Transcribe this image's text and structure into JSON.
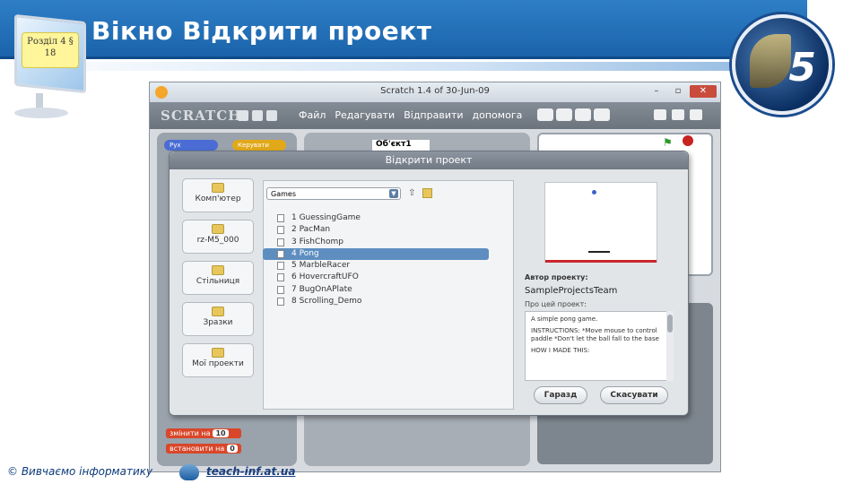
{
  "slide": {
    "title": "Вікно Відкрити проект",
    "section_label_line1": "Розділ 4 §",
    "section_label_line2": "18",
    "logo_number": "5"
  },
  "footer": {
    "copyright": "© Вивчаємо інформатику",
    "site": "teach-inf.at.ua"
  },
  "scratch": {
    "window_title": "Scratch 1.4 of 30-Jun-09",
    "logo_text": "SCRATCH",
    "menu": [
      "Файл",
      "Редагувати",
      "Відправити",
      "допомога"
    ],
    "window_buttons": [
      "–",
      "▫",
      "✕"
    ],
    "categories": [
      "Рух",
      "Керувати"
    ],
    "sprite_name": "Об'єкт1",
    "blocks": [
      {
        "text": "змінити на",
        "value": "10"
      },
      {
        "text": "встановити на",
        "value": "0"
      }
    ]
  },
  "dialog": {
    "title": "Відкрити проект",
    "places": [
      "Комп'ютер",
      "rz-M5_000",
      "Стільниця",
      "Зразки",
      "Мої проекти"
    ],
    "folder": "Games",
    "files": [
      "1 GuessingGame",
      "2 PacMan",
      "3 FishChomp",
      "4 Pong",
      "5 MarbleRacer",
      "6 HovercraftUFO",
      "7 BugOnAPlate",
      "8 Scrolling_Demo"
    ],
    "selected_index": 3,
    "author_label": "Автор проекту:",
    "author": "SampleProjectsTeam",
    "notes_label": "Про цей проект:",
    "notes": [
      "A simple pong game.",
      "INSTRUCTIONS: *Move mouse to control paddle *Don't let the ball fall to the base",
      "HOW I MADE THIS:"
    ],
    "ok_label": "Гаразд",
    "cancel_label": "Скасувати"
  },
  "colors": {
    "header_blue": "#1b63ab",
    "selection_blue": "#5e8ec0",
    "close_red": "#c84b3c"
  }
}
